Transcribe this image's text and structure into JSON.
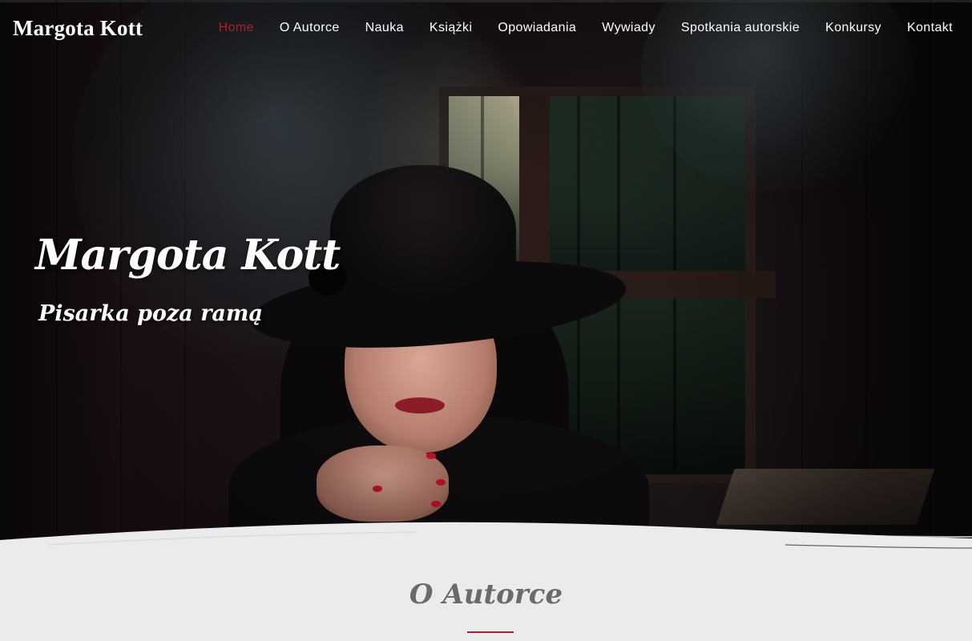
{
  "brand": {
    "name": "Margota Kott"
  },
  "nav": {
    "items": [
      {
        "label": "Home",
        "active": true
      },
      {
        "label": "O Autorce",
        "active": false
      },
      {
        "label": "Nauka",
        "active": false
      },
      {
        "label": "Książki",
        "active": false
      },
      {
        "label": "Opowiadania",
        "active": false
      },
      {
        "label": "Wywiady",
        "active": false
      },
      {
        "label": "Spotkania autorskie",
        "active": false
      },
      {
        "label": "Konkursy",
        "active": false
      },
      {
        "label": "Kontakt",
        "active": false
      }
    ]
  },
  "hero": {
    "title": "Margota Kott",
    "subtitle": "Pisarka poza ramą"
  },
  "about": {
    "title": "O Autorce"
  },
  "colors": {
    "accent": "#b01e2e",
    "section_bg": "#ebebee",
    "heading_gray": "#6a6a6a"
  }
}
